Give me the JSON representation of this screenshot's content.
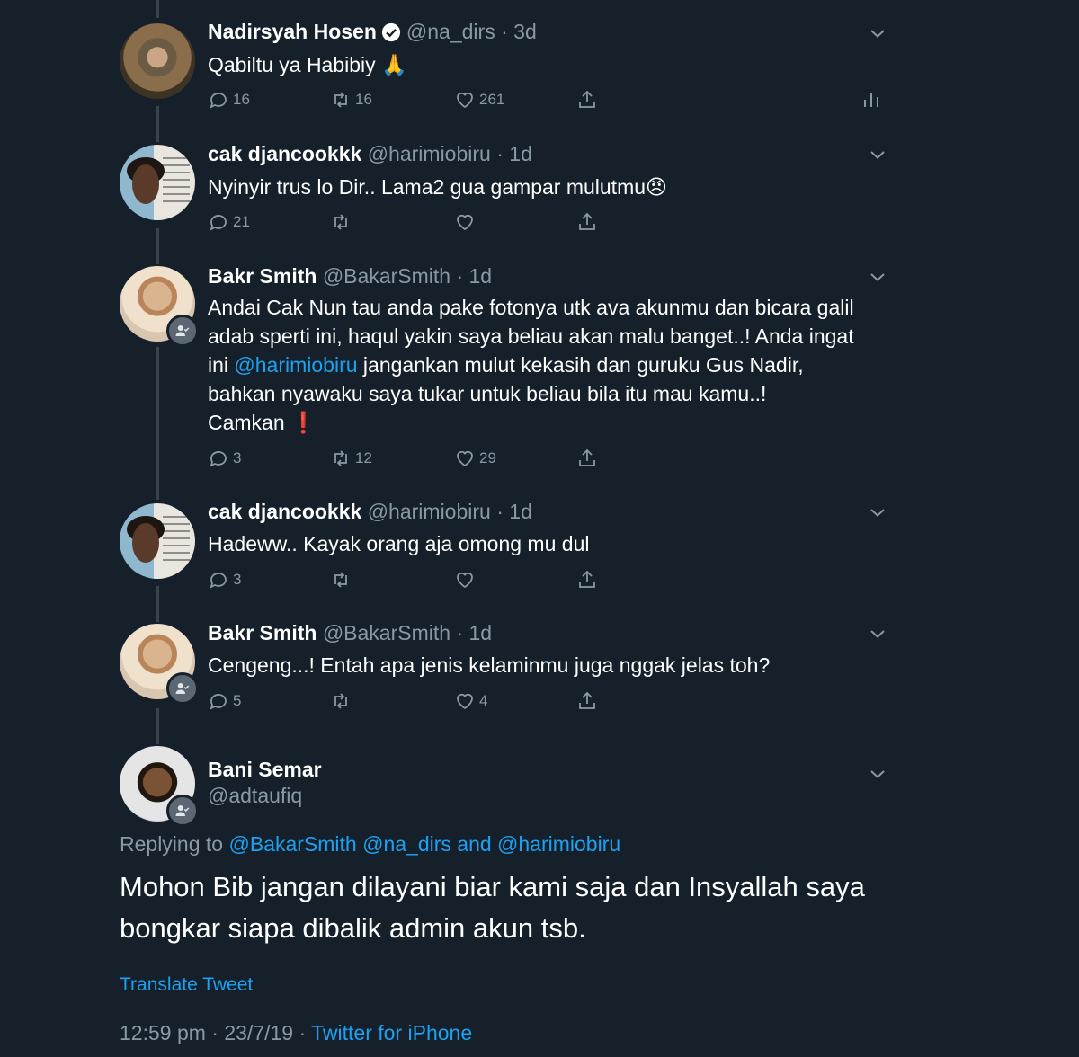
{
  "tweets": [
    {
      "name": "Nadirsyah Hosen",
      "verified": true,
      "handle": "@na_dirs",
      "time": "3d",
      "text": "Qabiltu ya Habibiy 🙏",
      "replies": "16",
      "retweets": "16",
      "likes": "261",
      "show_stats": true
    },
    {
      "name": "cak djancookkk",
      "handle": "@harimiobiru",
      "time": "1d",
      "text": "Nyinyir trus lo Dir.. Lama2 gua gampar mulutmu😠",
      "replies": "21",
      "retweets": "",
      "likes": ""
    },
    {
      "name": "Bakr Smith",
      "handle": "@BakarSmith",
      "time": "1d",
      "text_lines": [
        "Andai Cak Nun tau anda pake fotonya utk ava akunmu dan bicara galil",
        "adab sperti ini, haqul yakin saya beliau akan malu banget..! Anda ingat",
        "jangankan mulut kekasih dan guruku Gus Nadir,",
        "bahkan nyawaku saya tukar untuk beliau bila itu mau kamu..!",
        "Camkan ❗"
      ],
      "line3_prefix": "ini",
      "mention": "@harimiobiru",
      "replies": "3",
      "retweets": "12",
      "likes": "29"
    },
    {
      "name": "cak djancookkk",
      "handle": "@harimiobiru",
      "time": "1d",
      "text": "Hadeww.. Kayak orang aja omong mu dul",
      "replies": "3",
      "retweets": "",
      "likes": ""
    },
    {
      "name": "Bakr Smith",
      "handle": "@BakarSmith",
      "time": "1d",
      "text": "Cengeng...! Entah apa jenis kelaminmu juga nggak jelas toh?",
      "replies": "5",
      "retweets": "",
      "likes": "4"
    }
  ],
  "main_tweet": {
    "name": "Bani Semar",
    "handle": "@adtaufiq",
    "replying_prefix": "Replying to",
    "replying_to_1": "@BakarSmith",
    "replying_to_2": "@na_dirs",
    "replying_and": "and",
    "replying_to_3": "@harimiobiru",
    "text_line_1": "Mohon Bib jangan dilayani biar kami saja dan Insyallah saya",
    "text_line_2": "bongkar siapa dibalik admin akun tsb.",
    "translate_label": "Translate Tweet",
    "time": "12:59 pm",
    "date": "23/7/19",
    "source": "Twitter for iPhone"
  },
  "colors": {
    "background": "#15202b",
    "text": "#ffffff",
    "secondary": "#8899a6",
    "link": "#1da1f2",
    "thread_line": "#38444d"
  },
  "icons": {
    "reply": "reply-icon",
    "retweet": "retweet-icon",
    "like": "heart-icon",
    "share": "share-icon",
    "stats": "stats-icon",
    "chevron": "chevron-down-icon",
    "verified": "verified-badge-icon",
    "follow_badge": "person-check-icon"
  }
}
